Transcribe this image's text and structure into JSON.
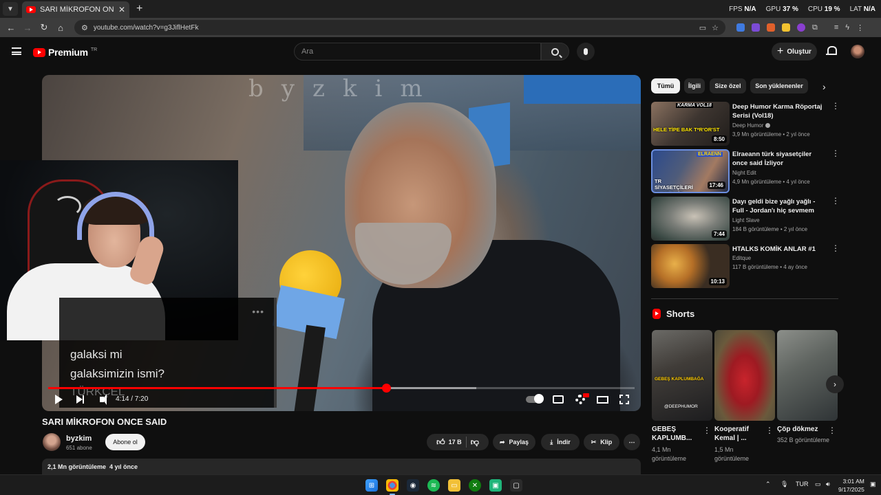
{
  "browser": {
    "tab_title": "SARI MİKROFON ONCE SAID -",
    "url": "youtube.com/watch?v=g3JiflHetFk",
    "stats": {
      "fps_label": "FPS",
      "fps_value": "N/A",
      "gpu_label": "GPU",
      "gpu_value": "37 %",
      "cpu_label": "CPU",
      "cpu_value": "19 %",
      "lat_label": "LAT",
      "lat_value": "N/A"
    },
    "extension_colors": [
      "#3f7ae0",
      "#7b4bd6",
      "#e0602b",
      "#f2c230",
      "#8a3fd0",
      "#cccccc"
    ]
  },
  "header": {
    "logo_text": "Premium",
    "logo_country": "TR",
    "search_placeholder": "Ara",
    "create_label": "Oluştur"
  },
  "player": {
    "watermark": "byzkim",
    "time": "4:14 / 7:20",
    "progress": 0.577,
    "buffered": 0.73
  },
  "chat": {
    "lines": [
      "galaksi mi",
      "galaksimizin ismi?",
      "TÜRKÇEL"
    ]
  },
  "video": {
    "title": "SARI MİKROFON ONCE SAID",
    "channel": "byzkim",
    "subs": "651 abone",
    "subscribe": "Abone ol",
    "likes": "17 B",
    "share": "Paylaş",
    "download": "İndir",
    "clip": "Klip",
    "views": "2,1 Mn görüntüleme",
    "age": "4 yıl önce"
  },
  "chips": [
    "Tümü",
    "İlgili",
    "Size özel",
    "Son yüklenenler"
  ],
  "recommendations": [
    {
      "title": "Deep Humor Karma Röportaj Serisi (Vol18)",
      "channel": "Deep Humor",
      "meta": "3,9 Mn görüntüleme • 2 yıl önce",
      "duration": "8:50",
      "thumb_text": "HELE TİPE BAK T*R'OR'ST",
      "thumb_top": "KARMA VOL18"
    },
    {
      "title": "Elraeann türk siyasetçiler once said İzliyor",
      "channel": "Night Edit",
      "meta": "4,9 Mn görüntüleme • 4 yıl önce",
      "duration": "17:46",
      "thumb_text": "TR SİYASETÇİLERİ ONCE SAİD",
      "thumb_top": "ELRAENN"
    },
    {
      "title": "Dayı geldi bize yağlı yağlı - Full - Jordan'ı hiç sevmem",
      "channel": "Light Slave",
      "meta": "184 B görüntüleme • 2 yıl önce",
      "duration": "7:44"
    },
    {
      "title": "HTALKS KOMİK ANLAR #1",
      "channel": "Editque",
      "meta": "117 B görüntüleme • 4 ay önce",
      "duration": "10:13"
    }
  ],
  "shorts": {
    "heading": "Shorts",
    "items": [
      {
        "title": "GEBEŞ KAPLUMB...",
        "views": "4,1 Mn görüntüleme",
        "overlay": "GEBEŞ KAPLUMBAĞA",
        "handle": "@DEEPHUMOR"
      },
      {
        "title": "Kooperatif Kemal | ...",
        "views": "1,5 Mn görüntüleme"
      },
      {
        "title": "Çöp dökmez",
        "views": "352 B görüntüleme"
      }
    ]
  },
  "taskbar": {
    "lang": "TUR",
    "time": "3:01 AM",
    "date": "9/17/2025"
  }
}
